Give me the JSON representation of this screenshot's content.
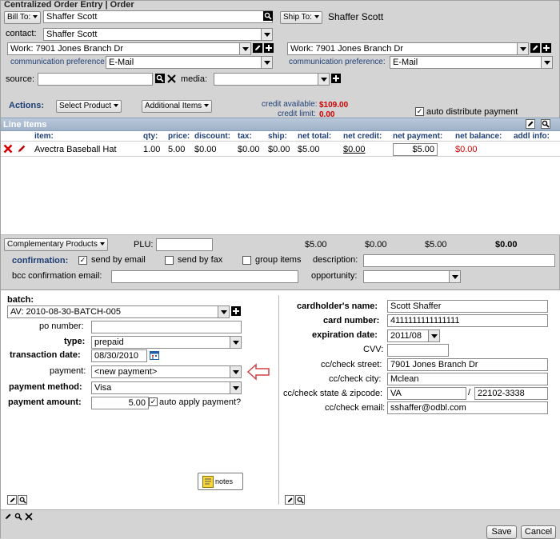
{
  "window": {
    "title": "Centralized Order Entry | Order"
  },
  "bill_to": {
    "button_label": "Bill To:",
    "name": "Shaffer Scott",
    "contact_label": "contact:",
    "contact_value": "Shaffer Scott",
    "address_value": "Work: 7901 Jones Branch Dr",
    "comm_pref_label": "communication preference:",
    "comm_pref_value": "E-Mail"
  },
  "ship_to": {
    "button_label": "Ship To:",
    "name": "Shaffer Scott",
    "address_value": "Work: 7901 Jones Branch Dr",
    "comm_pref_label": "communication preference:",
    "comm_pref_value": "E-Mail"
  },
  "source": {
    "label": "source:",
    "value": ""
  },
  "media": {
    "label": "media:",
    "value": ""
  },
  "actions": {
    "label": "Actions:",
    "select_product": "Select Product",
    "additional_items": "Additional Items",
    "credit_available_label": "credit available:",
    "credit_available_value": "$109.00",
    "credit_limit_label": "credit limit:",
    "credit_limit_value": "0.00",
    "auto_distribute_label": "auto distribute payment"
  },
  "line_items": {
    "title": "Line Items",
    "columns": [
      "item:",
      "qty:",
      "price:",
      "discount:",
      "tax:",
      "ship:",
      "net total:",
      "net credit:",
      "net payment:",
      "net balance:",
      "addl info:"
    ],
    "rows": [
      {
        "item": "Avectra Baseball Hat",
        "qty": "1.00",
        "price": "5.00",
        "discount": "$0.00",
        "tax": "$0.00",
        "ship": "$0.00",
        "net_total": "$5.00",
        "net_credit": "$0.00",
        "net_payment": "$5.00",
        "net_balance": "$0.00"
      }
    ],
    "totals": {
      "net_total": "$5.00",
      "net_credit": "$0.00",
      "net_payment": "$5.00",
      "net_balance": "$0.00"
    },
    "complementary_products": "Complementary Products",
    "plu_label": "PLU:"
  },
  "confirmation": {
    "label": "confirmation:",
    "send_by_email": "send by email",
    "send_by_fax": "send by fax",
    "group_items": "group items",
    "description_label": "description:",
    "bcc_label": "bcc confirmation email:",
    "opportunity_label": "opportunity:"
  },
  "payment": {
    "batch_label": "batch:",
    "batch_value": "AV: 2010-08-30-BATCH-005",
    "po_label": "po number:",
    "type_label": "type:",
    "type_value": "prepaid",
    "transaction_date_label": "transaction date:",
    "transaction_date_value": "08/30/2010",
    "payment_label": "payment:",
    "payment_value": "<new payment>",
    "payment_method_label": "payment method:",
    "payment_method_value": "Visa",
    "payment_amount_label": "payment amount:",
    "payment_amount_value": "5.00",
    "auto_apply_label": "auto apply payment?",
    "notes_label": "notes"
  },
  "card": {
    "cardholder_label": "cardholder's name:",
    "cardholder_value": "Scott Shaffer",
    "card_number_label": "card number:",
    "card_number_value": "4111111111111111",
    "expiration_label": "expiration date:",
    "expiration_value": "2011/08",
    "cvv_label": "CVV:",
    "street_label": "cc/check street:",
    "street_value": "7901 Jones Branch Dr",
    "city_label": "cc/check city:",
    "city_value": "Mclean",
    "state_zip_label": "cc/check state & zipcode:",
    "state_value": "VA",
    "slash": "/",
    "zip_value": "22102-3338",
    "email_label": "cc/check email:",
    "email_value": "sshaffer@odbl.com"
  },
  "footer": {
    "save": "Save",
    "cancel": "Cancel"
  },
  "colors": {
    "accent_red": "#cc0000",
    "header_blue": "#a9bbd0"
  }
}
